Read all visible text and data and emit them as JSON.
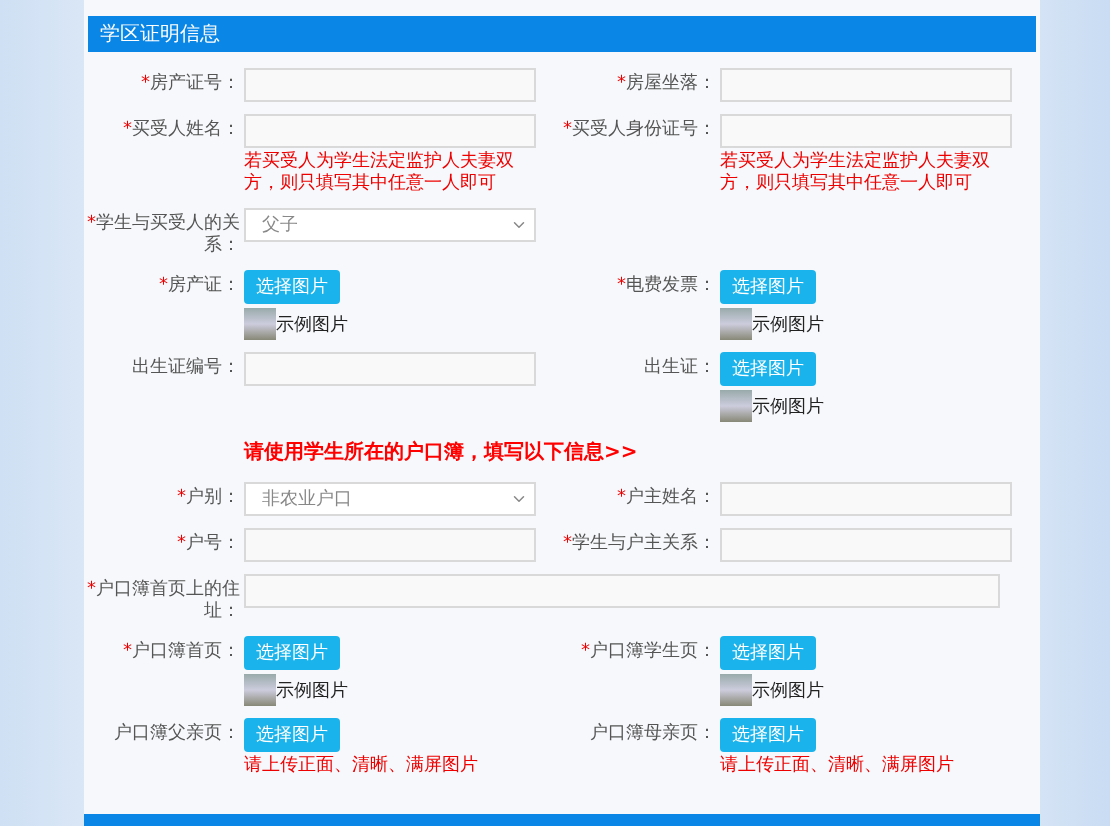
{
  "panel": {
    "title": "学区证明信息"
  },
  "rows": [
    {
      "kind": "pair",
      "cells": [
        {
          "kind": "text",
          "asterisk": "*",
          "label": "房产证号："
        },
        {
          "kind": "text",
          "asterisk": "*",
          "label": "房屋坐落："
        }
      ]
    },
    {
      "kind": "pair",
      "cells": [
        {
          "kind": "text",
          "asterisk": "*",
          "label": "买受人姓名：",
          "note": "若买受人为学生法定监护人夫妻双方，则只填写其中任意一人即可"
        },
        {
          "kind": "text",
          "asterisk": "*",
          "label": "买受人身份证号：",
          "note": "若买受人为学生法定监护人夫妻双方，则只填写其中任意一人即可"
        }
      ]
    },
    {
      "kind": "pair",
      "cells": [
        {
          "kind": "select",
          "asterisk": "*",
          "label": "学生与买受人的关系：",
          "value": "父子"
        }
      ]
    },
    {
      "kind": "pair",
      "cells": [
        {
          "kind": "upload",
          "asterisk": "*",
          "label": "房产证：",
          "button": "选择图片",
          "example": "示例图片"
        },
        {
          "kind": "upload",
          "asterisk": "*",
          "label": "电费发票：",
          "button": "选择图片",
          "example": "示例图片"
        }
      ]
    },
    {
      "kind": "pair",
      "cells": [
        {
          "kind": "text",
          "label": "出生证编号："
        },
        {
          "kind": "upload",
          "label": "出生证：",
          "button": "选择图片",
          "example": "示例图片"
        }
      ]
    },
    {
      "kind": "notice",
      "text": "请使用学生所在的户口簿，填写以下信息>>"
    },
    {
      "kind": "pair",
      "cells": [
        {
          "kind": "select",
          "asterisk": "*",
          "label": "户别：",
          "value": "非农业户口"
        },
        {
          "kind": "text",
          "asterisk": "*",
          "label": "户主姓名："
        }
      ]
    },
    {
      "kind": "pair",
      "cells": [
        {
          "kind": "text",
          "asterisk": "*",
          "label": "户号："
        },
        {
          "kind": "text",
          "asterisk": "*",
          "label": "学生与户主关系："
        }
      ]
    },
    {
      "kind": "wide",
      "cells": [
        {
          "kind": "text",
          "asterisk": "*",
          "label": "户口簿首页上的住址："
        }
      ]
    },
    {
      "kind": "pair",
      "cells": [
        {
          "kind": "upload",
          "asterisk": "*",
          "label": "户口簿首页：",
          "button": "选择图片",
          "example": "示例图片"
        },
        {
          "kind": "upload",
          "asterisk": "*",
          "label": "户口簿学生页：",
          "button": "选择图片",
          "example": "示例图片"
        }
      ]
    },
    {
      "kind": "pair",
      "cells": [
        {
          "kind": "upload",
          "label": "户口簿父亲页：",
          "button": "选择图片",
          "note": "请上传正面、清晰、满屏图片"
        },
        {
          "kind": "upload",
          "label": "户口簿母亲页：",
          "button": "选择图片",
          "note": "请上传正面、清晰、满屏图片"
        }
      ]
    }
  ]
}
